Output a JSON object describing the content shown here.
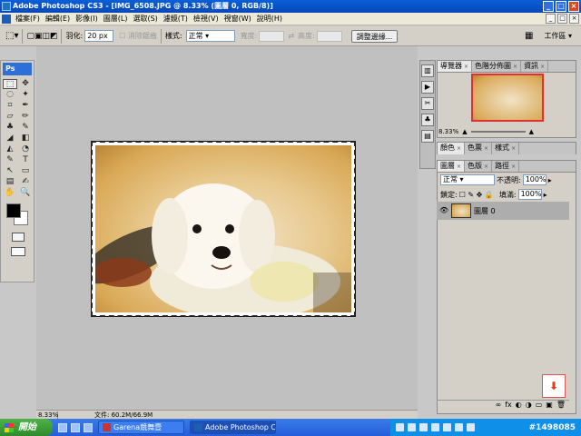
{
  "window": {
    "title": "Adobe Photoshop CS3 - [IMG_6508.JPG @ 8.33% (圖層 0, RGB/8)]",
    "controls": [
      "_",
      "□",
      "×"
    ]
  },
  "menubar": {
    "items": [
      "檔案(F)",
      "編輯(E)",
      "影像(I)",
      "圖層(L)",
      "選取(S)",
      "濾鏡(T)",
      "檢視(V)",
      "視窗(W)",
      "說明(H)"
    ],
    "doc_controls": [
      "_",
      "□",
      "×"
    ]
  },
  "options_bar": {
    "feather_label": "羽化:",
    "feather_value": "20 px",
    "antialias_label": "消除鋸齒",
    "style_label": "樣式:",
    "style_value": "正常",
    "width_label": "寬度:",
    "height_label": "高度:",
    "refine_button": "調整邊緣...",
    "workspace_label": "工作區 ▾"
  },
  "toolbox": {
    "header": "Ps",
    "tools": [
      "⬚",
      "✥",
      "◌",
      "✦",
      "⌗",
      "✒",
      "▱",
      "✏",
      "♣",
      "✎",
      "◢",
      "◧",
      "◭",
      "◔",
      "✎",
      "T",
      "↖",
      "▭",
      "▤",
      "✍",
      "✋",
      "🔍"
    ],
    "foreground_color": "#000000",
    "background_color": "#ffffff"
  },
  "panels": {
    "navigator_tabs": [
      "導覽器",
      "色階分佈圖",
      "資訊"
    ],
    "navigator_zoom": "8.33%",
    "color_tabs": [
      "顏色",
      "色票",
      "樣式"
    ],
    "layers_tabs": [
      "圖層",
      "色版",
      "路徑"
    ],
    "blend_mode": "正常",
    "opacity_label": "不透明:",
    "opacity_value": "100%",
    "lock_label": "鎖定:",
    "fill_label": "填滿:",
    "fill_value": "100%",
    "layer_name": "圖層 0",
    "footer_icons": [
      "∞",
      "fx",
      "◐",
      "◑",
      "▭",
      "▣",
      "🗑"
    ]
  },
  "status": {
    "zoom": "8.33%",
    "file_info": "文件: 60.2M/66.9M"
  },
  "taskbar": {
    "start_label": "開始",
    "tasks": [
      {
        "label": "Garena競舞壹",
        "active": false
      },
      {
        "label": "Adobe Photoshop CS...",
        "active": true
      }
    ],
    "watermark": "#1498085"
  },
  "colors": {
    "title_blue": "#0a5fd8",
    "taskbar_blue": "#245edb",
    "start_green": "#2f8a2b"
  }
}
